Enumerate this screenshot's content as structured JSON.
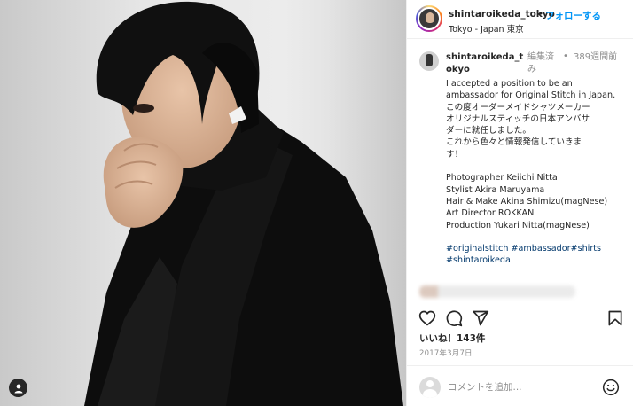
{
  "post": {
    "image_alt": "",
    "person_tag_icon": "person-icon"
  },
  "header": {
    "username": "shintaroikeda_tokyo",
    "separator": "•",
    "follow_label": "フォローする",
    "location": "Tokyo - Japan 東京"
  },
  "caption": {
    "username": "shintaroikeda_tokyo",
    "edited": "編集済み",
    "separator": "•",
    "time": "389週間前",
    "lines": [
      "I accepted a position to be an",
      "ambassador for Original Stitch in Japan.",
      "この度オーダーメイドシャツメーカー",
      "オリジナルスティッチの日本アンバサ",
      "ダーに就任しました。",
      "これから色々と情報発信していきま",
      "す！"
    ],
    "credits": [
      "Photographer Keiichi Nitta",
      "Stylist Akira Maruyama",
      "Hair & Make Akina Shimizu(magNese)",
      "Art Director ROKKAN",
      "Production Yukari Nitta(magNese)"
    ],
    "hashtags_line1": [
      "#originalstitch",
      "#ambassador",
      "#shirts"
    ],
    "hashtags_line2": "#shintaroikeda"
  },
  "actions": {
    "like_icon": "heart-icon",
    "comment_icon": "comment-icon",
    "share_icon": "share-icon",
    "save_icon": "bookmark-icon",
    "likes_text": "いいね！143件",
    "date": "2017年3月7日"
  },
  "comment_bar": {
    "placeholder": "コメントを追加...",
    "emoji_icon": "emoji-icon"
  },
  "colors": {
    "link": "#0095f6",
    "hashtag": "#00376b",
    "muted": "#8e8e8e",
    "text": "#262626"
  }
}
